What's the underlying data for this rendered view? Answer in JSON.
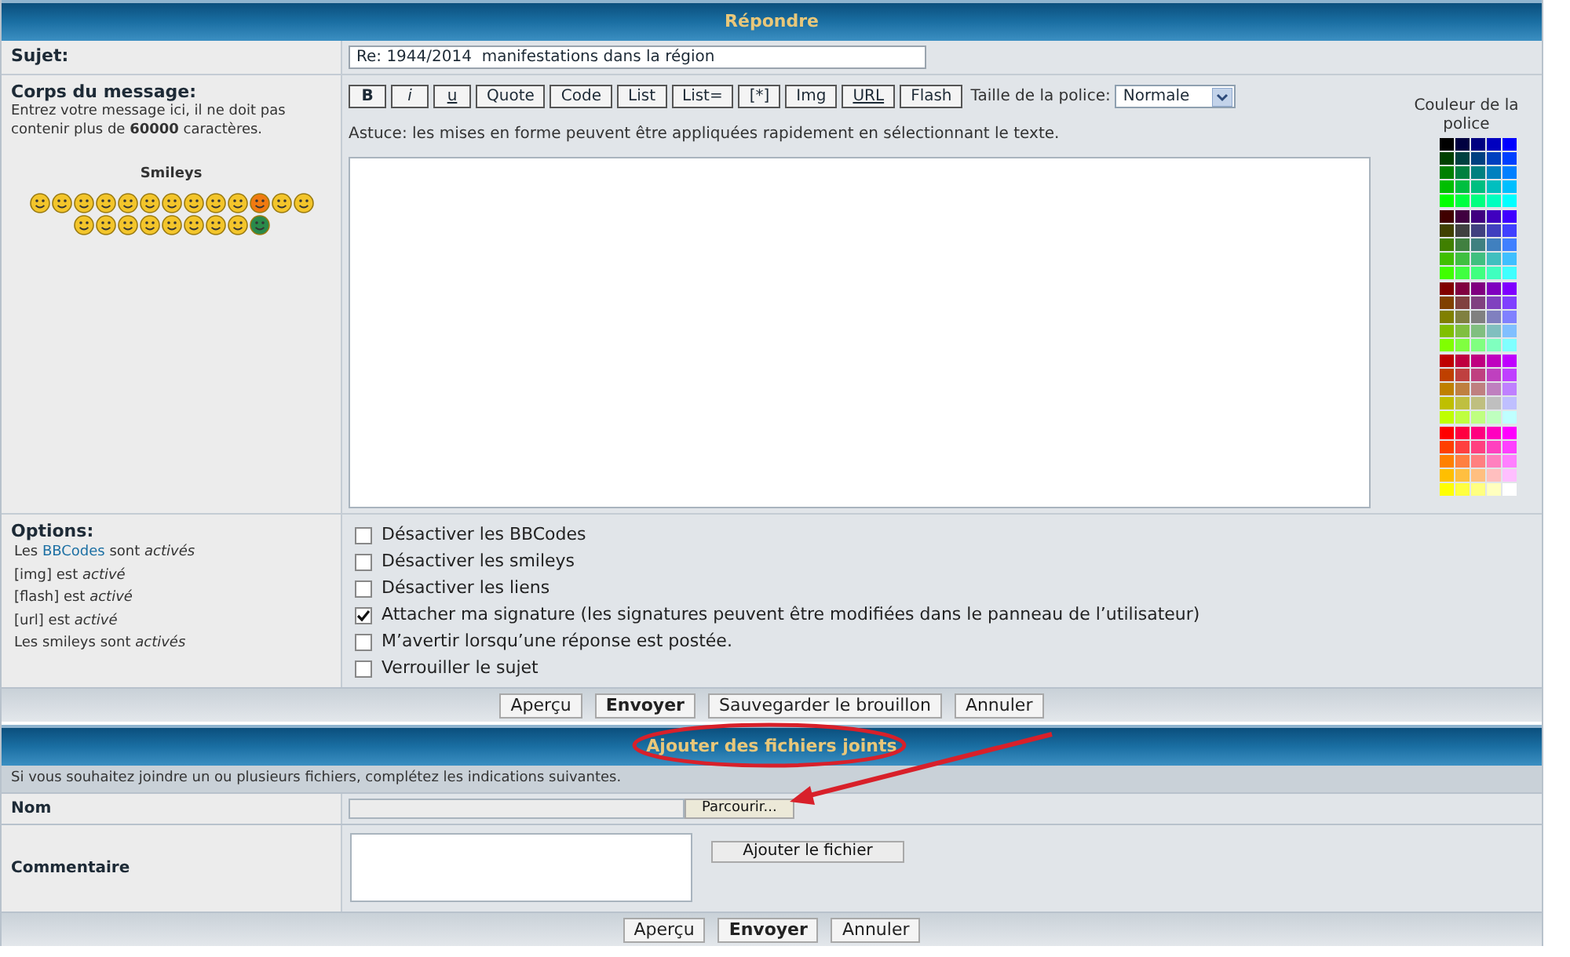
{
  "header": {
    "title": "Répondre"
  },
  "subject": {
    "label": "Sujet:",
    "value": "Re: 1944/2014  manifestations dans la région"
  },
  "body": {
    "label": "Corps du message:",
    "note": "Entrez votre message ici, il ne doit pas contenir plus de **60000** caractères.",
    "smileys_title": "Smileys",
    "toolbar": [
      {
        "label": "B",
        "kind": "bold"
      },
      {
        "label": "i",
        "kind": "italic"
      },
      {
        "label": "u",
        "kind": "underline"
      },
      {
        "label": "Quote",
        "kind": "plain"
      },
      {
        "label": "Code",
        "kind": "plain"
      },
      {
        "label": "List",
        "kind": "plain"
      },
      {
        "label": "List=",
        "kind": "plain"
      },
      {
        "label": "[*]",
        "kind": "plain"
      },
      {
        "label": "Img",
        "kind": "plain"
      },
      {
        "label": "URL",
        "kind": "underline"
      },
      {
        "label": "Flash",
        "kind": "plain"
      }
    ],
    "font_size": {
      "label": "Taille de la police:",
      "value": "Normale"
    },
    "tip": "Astuce: les mises en forme peuvent être appliquées rapidement en sélectionnant le texte.",
    "color_title": "Couleur de la police"
  },
  "options": {
    "label": "Options:",
    "rules": [
      {
        "prefix": "Les ",
        "link": "BBCodes",
        "suffix": " sont *activés*"
      },
      {
        "prefix": "[img] est *activé*"
      },
      {
        "prefix": "[flash] est *activé*"
      },
      {
        "prefix": "[url] est *activé*"
      },
      {
        "prefix": "Les smileys sont *activés*"
      }
    ],
    "checkboxes": [
      {
        "label": "Désactiver les BBCodes",
        "checked": false
      },
      {
        "label": "Désactiver les smileys",
        "checked": false
      },
      {
        "label": "Désactiver les liens",
        "checked": false
      },
      {
        "label": "Attacher ma signature (les signatures peuvent être modifiées dans le panneau de l’utilisateur)",
        "checked": true
      },
      {
        "label": "M’avertir lorsqu’une réponse est postée.",
        "checked": false
      },
      {
        "label": "Verrouiller le sujet",
        "checked": false
      }
    ]
  },
  "actions": [
    {
      "label": "Aperçu",
      "primary": false
    },
    {
      "label": "Envoyer",
      "primary": true
    },
    {
      "label": "Sauvegarder le brouillon",
      "primary": false
    },
    {
      "label": "Annuler",
      "primary": false
    }
  ],
  "attachments": {
    "title": "Ajouter des fichiers joints",
    "intro": "Si vous souhaitez joindre un ou plusieurs fichiers, complétez les indications suivantes.",
    "name_label": "Nom",
    "browse_button": "Parcourir...",
    "comment_label": "Commentaire",
    "add_button": "Ajouter le fichier"
  },
  "bottom_actions": [
    {
      "label": "Aperçu",
      "primary": false
    },
    {
      "label": "Envoyer",
      "primary": true
    },
    {
      "label": "Annuler",
      "primary": false
    }
  ]
}
